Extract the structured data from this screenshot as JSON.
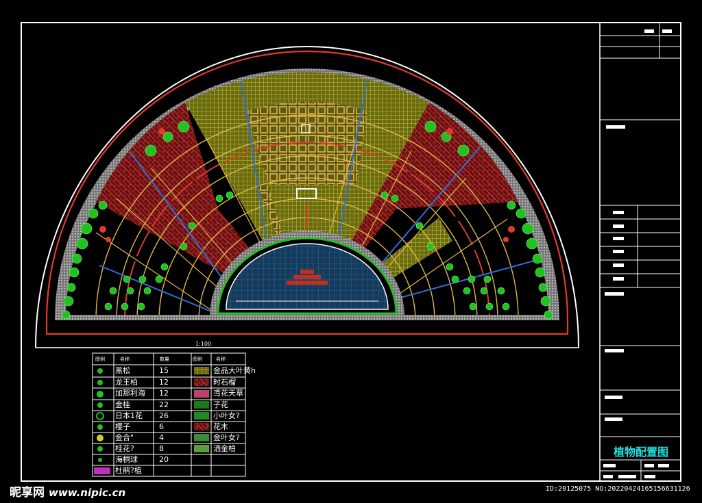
{
  "drawing": {
    "title_block_title": "植物配置图",
    "scale_label": "1:100"
  },
  "legend": {
    "headers": [
      "图例",
      "名称",
      "数量",
      "图例",
      "名称"
    ],
    "left_rows": [
      {
        "name": "黑松",
        "qty": "15"
      },
      {
        "name": "龙王柏",
        "qty": "12"
      },
      {
        "name": "加那利海",
        "qty": "12"
      },
      {
        "name": "金桂",
        "qty": "22"
      },
      {
        "name": "日本1花",
        "qty": "26"
      },
      {
        "name": "樱子",
        "qty": "6"
      },
      {
        "name": "金合\"",
        "qty": "4"
      },
      {
        "name": "桂花?",
        "qty": "8"
      },
      {
        "name": "海桐球",
        "qty": "20"
      },
      {
        "name": "杜鹃?植",
        "qty": ""
      }
    ],
    "right_rows": [
      {
        "name": "金品大叶黄h"
      },
      {
        "name": "时石榴"
      },
      {
        "name": "鸢花天草"
      },
      {
        "name": "子花"
      },
      {
        "name": "小叶女?"
      },
      {
        "name": "花木"
      },
      {
        "name": "金叶女?"
      },
      {
        "name": "洒金柏"
      }
    ]
  },
  "footer": {
    "watermark_brand": "昵享网",
    "watermark_url": "www.nipic.cn",
    "image_id": "ID:20125075 NO:20220424165156631126"
  },
  "colors": {
    "frame": "#ffffff",
    "red_border": "#e23a2a",
    "fan_grid": "#e0b94a",
    "blue_lines": "#2f6fd8",
    "yellow_hatch": "#d8d23a",
    "brick": "#b02020",
    "plants": "#22c020",
    "pool": "#1d4f7a",
    "title_cyan": "#22e0e0"
  }
}
